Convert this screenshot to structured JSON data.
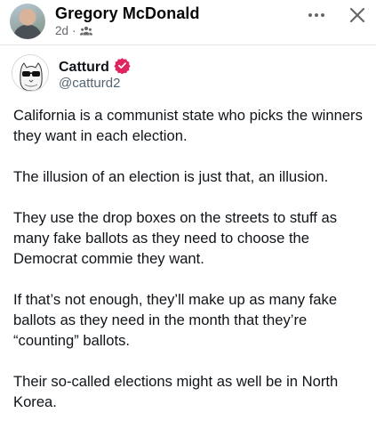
{
  "post": {
    "author_name": "Gregory McDonald",
    "time": "2d",
    "separator": "·",
    "audience_icon": "friends-icon"
  },
  "tweet": {
    "name": "Catturd",
    "handle": "@catturd2",
    "verified_color": "#e0245e",
    "paragraphs": [
      "California is a communist state who picks the winners they want in each election.",
      "The illusion of an election is just that, an illusion.",
      "They use the drop boxes on the streets to stuff as many fake ballots as they need to choose the Democrat commie they want.",
      "If that’s not enough, they’ll make up as many fake ballots as they need in the month that they’re “counting” ballots.",
      "Their so-called elections might as well be in North Korea."
    ]
  },
  "colors": {
    "text_primary": "#050505",
    "text_secondary": "#65676b",
    "divider": "#e4e6eb"
  }
}
